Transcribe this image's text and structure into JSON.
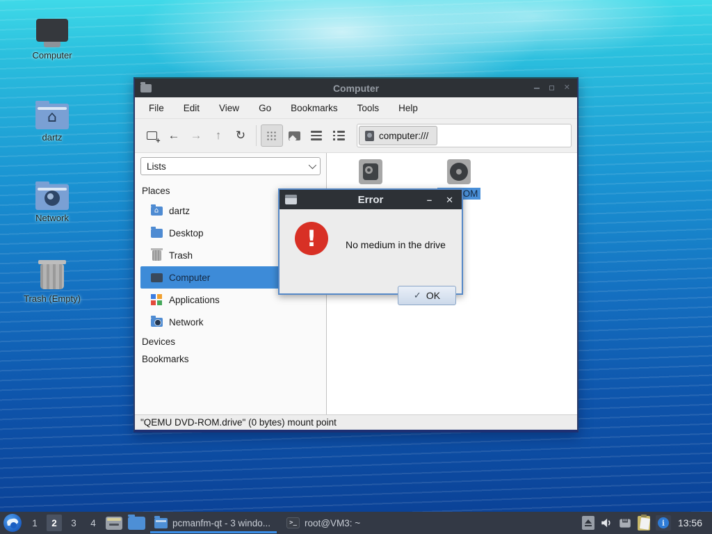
{
  "colors": {
    "selection_blue": "#3d8bd8",
    "error_red": "#d83025",
    "taskbar_bg": "#333945",
    "titlebar_bg": "#2d3136",
    "task_underline": "#3b8fe8"
  },
  "desktop": {
    "icons": [
      {
        "label": "Computer"
      },
      {
        "label": "dartz"
      },
      {
        "label": "Network"
      },
      {
        "label": "Trash (Empty)"
      }
    ]
  },
  "window": {
    "title": "Computer",
    "menu": [
      "File",
      "Edit",
      "View",
      "Go",
      "Bookmarks",
      "Tools",
      "Help"
    ],
    "toolbar": {
      "path": "computer:///"
    },
    "sidebar": {
      "view_mode": "Lists",
      "places_header": "Places",
      "places": [
        {
          "label": "dartz"
        },
        {
          "label": "Desktop"
        },
        {
          "label": "Trash"
        },
        {
          "label": "Computer",
          "selected": true
        },
        {
          "label": "Applications"
        },
        {
          "label": "Network"
        }
      ],
      "devices_header": "Devices",
      "bookmarks_header": "Bookmarks"
    },
    "files": {
      "selected_label": "VD-ROM"
    },
    "status": "\"QEMU DVD-ROM.drive\" (0 bytes) mount point"
  },
  "dialog": {
    "title": "Error",
    "message": "No medium in the drive",
    "ok": "OK",
    "check_glyph": "✓"
  },
  "taskbar": {
    "workspaces": [
      "1",
      "2",
      "3",
      "4"
    ],
    "active_workspace": "2",
    "tasks": [
      {
        "label": "pcmanfm-qt - 3 windo...",
        "active": true
      },
      {
        "label": "root@VM3: ~",
        "active": false
      }
    ],
    "terminal_glyph": ">_",
    "clock": "13:56"
  }
}
